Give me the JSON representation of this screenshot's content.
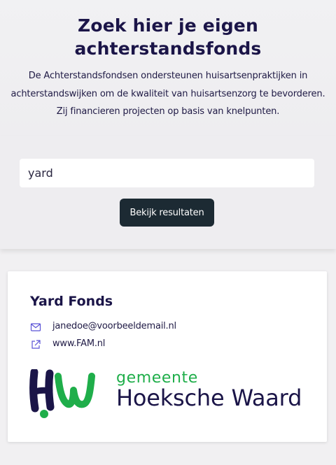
{
  "hero": {
    "title": "Zoek hier je eigen achterstandsfonds",
    "description_line1": "De Achterstandsfondsen ondersteunen huisartsenpraktijken in",
    "description_line2": "achterstandswijken om de kwaliteit van huisartsenzorg te bevorderen.",
    "description_line3": "Zij financieren projecten op basis van knelpunten."
  },
  "search": {
    "value": "yard",
    "button_label": "Bekijk resultaten"
  },
  "result_card": {
    "title": "Yard Fonds",
    "email": "janedoe@voorbeeldemail.nl",
    "website": "www.FAM.nl",
    "logo": {
      "line1": "gemeente",
      "line2": "Hoeksche Waard",
      "colors": {
        "green": "#1fae4a",
        "navy": "#1b1548"
      }
    }
  },
  "colors": {
    "accent_navy": "#1b1548",
    "button_bg": "#1c2a33",
    "icon_purple": "#5b53d6"
  }
}
